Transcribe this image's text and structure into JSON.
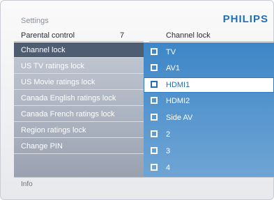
{
  "header": {
    "title": "Settings",
    "brand": "PHILIPS"
  },
  "breadcrumb": {
    "left": "Parental control",
    "count": "7",
    "right": "Channel lock"
  },
  "menu": [
    {
      "label": "Channel lock",
      "selected": true
    },
    {
      "label": "US TV ratings lock"
    },
    {
      "label": "US Movie ratings lock"
    },
    {
      "label": "Canada English ratings lock"
    },
    {
      "label": "Canada French ratings lock"
    },
    {
      "label": "Region ratings lock"
    },
    {
      "label": "Change PIN"
    }
  ],
  "channels": [
    {
      "label": "TV"
    },
    {
      "label": "AV1"
    },
    {
      "label": "HDMI1",
      "highlight": true
    },
    {
      "label": "HDMI2"
    },
    {
      "label": "Side AV"
    },
    {
      "label": "2"
    },
    {
      "label": "3"
    },
    {
      "label": "4"
    }
  ],
  "footer": {
    "info": "Info"
  }
}
